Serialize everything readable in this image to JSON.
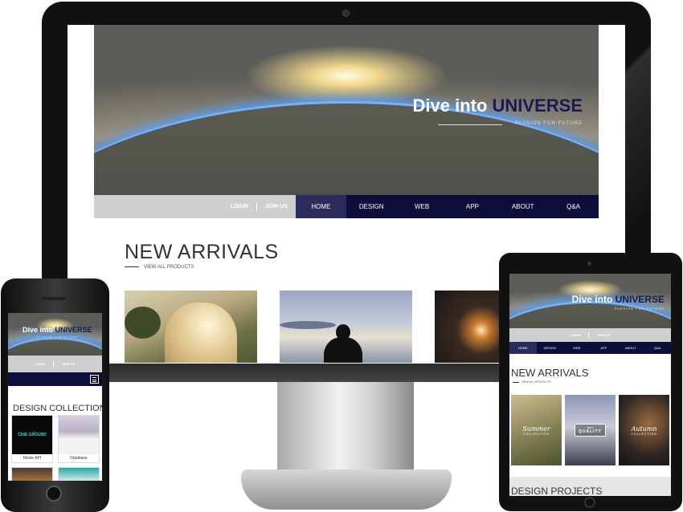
{
  "hero": {
    "title_a": "Dive into ",
    "title_b": "UNIVERSE",
    "tagline": "PASSION FOR FUTURE"
  },
  "desktop": {
    "account": {
      "login": "LOGIN",
      "join": "JOIN US"
    },
    "menu": [
      "HOME",
      "DESIGN",
      "WEB",
      "APP",
      "ABOUT",
      "Q&A"
    ],
    "section_title": "NEW ARRIVALS",
    "view_all": "VIEW ALL PRODUCTS"
  },
  "tablet": {
    "account": {
      "login": "LOGIN",
      "join": "JOIN US"
    },
    "menu": [
      "HOME",
      "DESIGN",
      "WEB",
      "APP",
      "ABOUT",
      "Q&A"
    ],
    "section_title": "NEW ARRIVALS",
    "view_all": "VIEW ALL PRODUCTS",
    "cards": [
      {
        "script": "Summer",
        "sub": "COLLECTION"
      },
      {
        "badge_top": "BEST",
        "badge": "QUALITY"
      },
      {
        "script": "Autumn",
        "sub": "COLLECTION"
      }
    ],
    "next_section": "DESIGN PROJECTS"
  },
  "phone": {
    "account": {
      "login": "LOGIN",
      "join": "JOIN US"
    },
    "section_title": "DESIGN COLLECTION",
    "items": [
      {
        "label": "Movie API",
        "thumb_text": "CINE GROUND"
      },
      {
        "label": "Database"
      }
    ]
  },
  "colors": {
    "navy": "#0d0d3a",
    "hero_blue": "#1a1a54",
    "nav_gray": "#cfcfcf"
  }
}
